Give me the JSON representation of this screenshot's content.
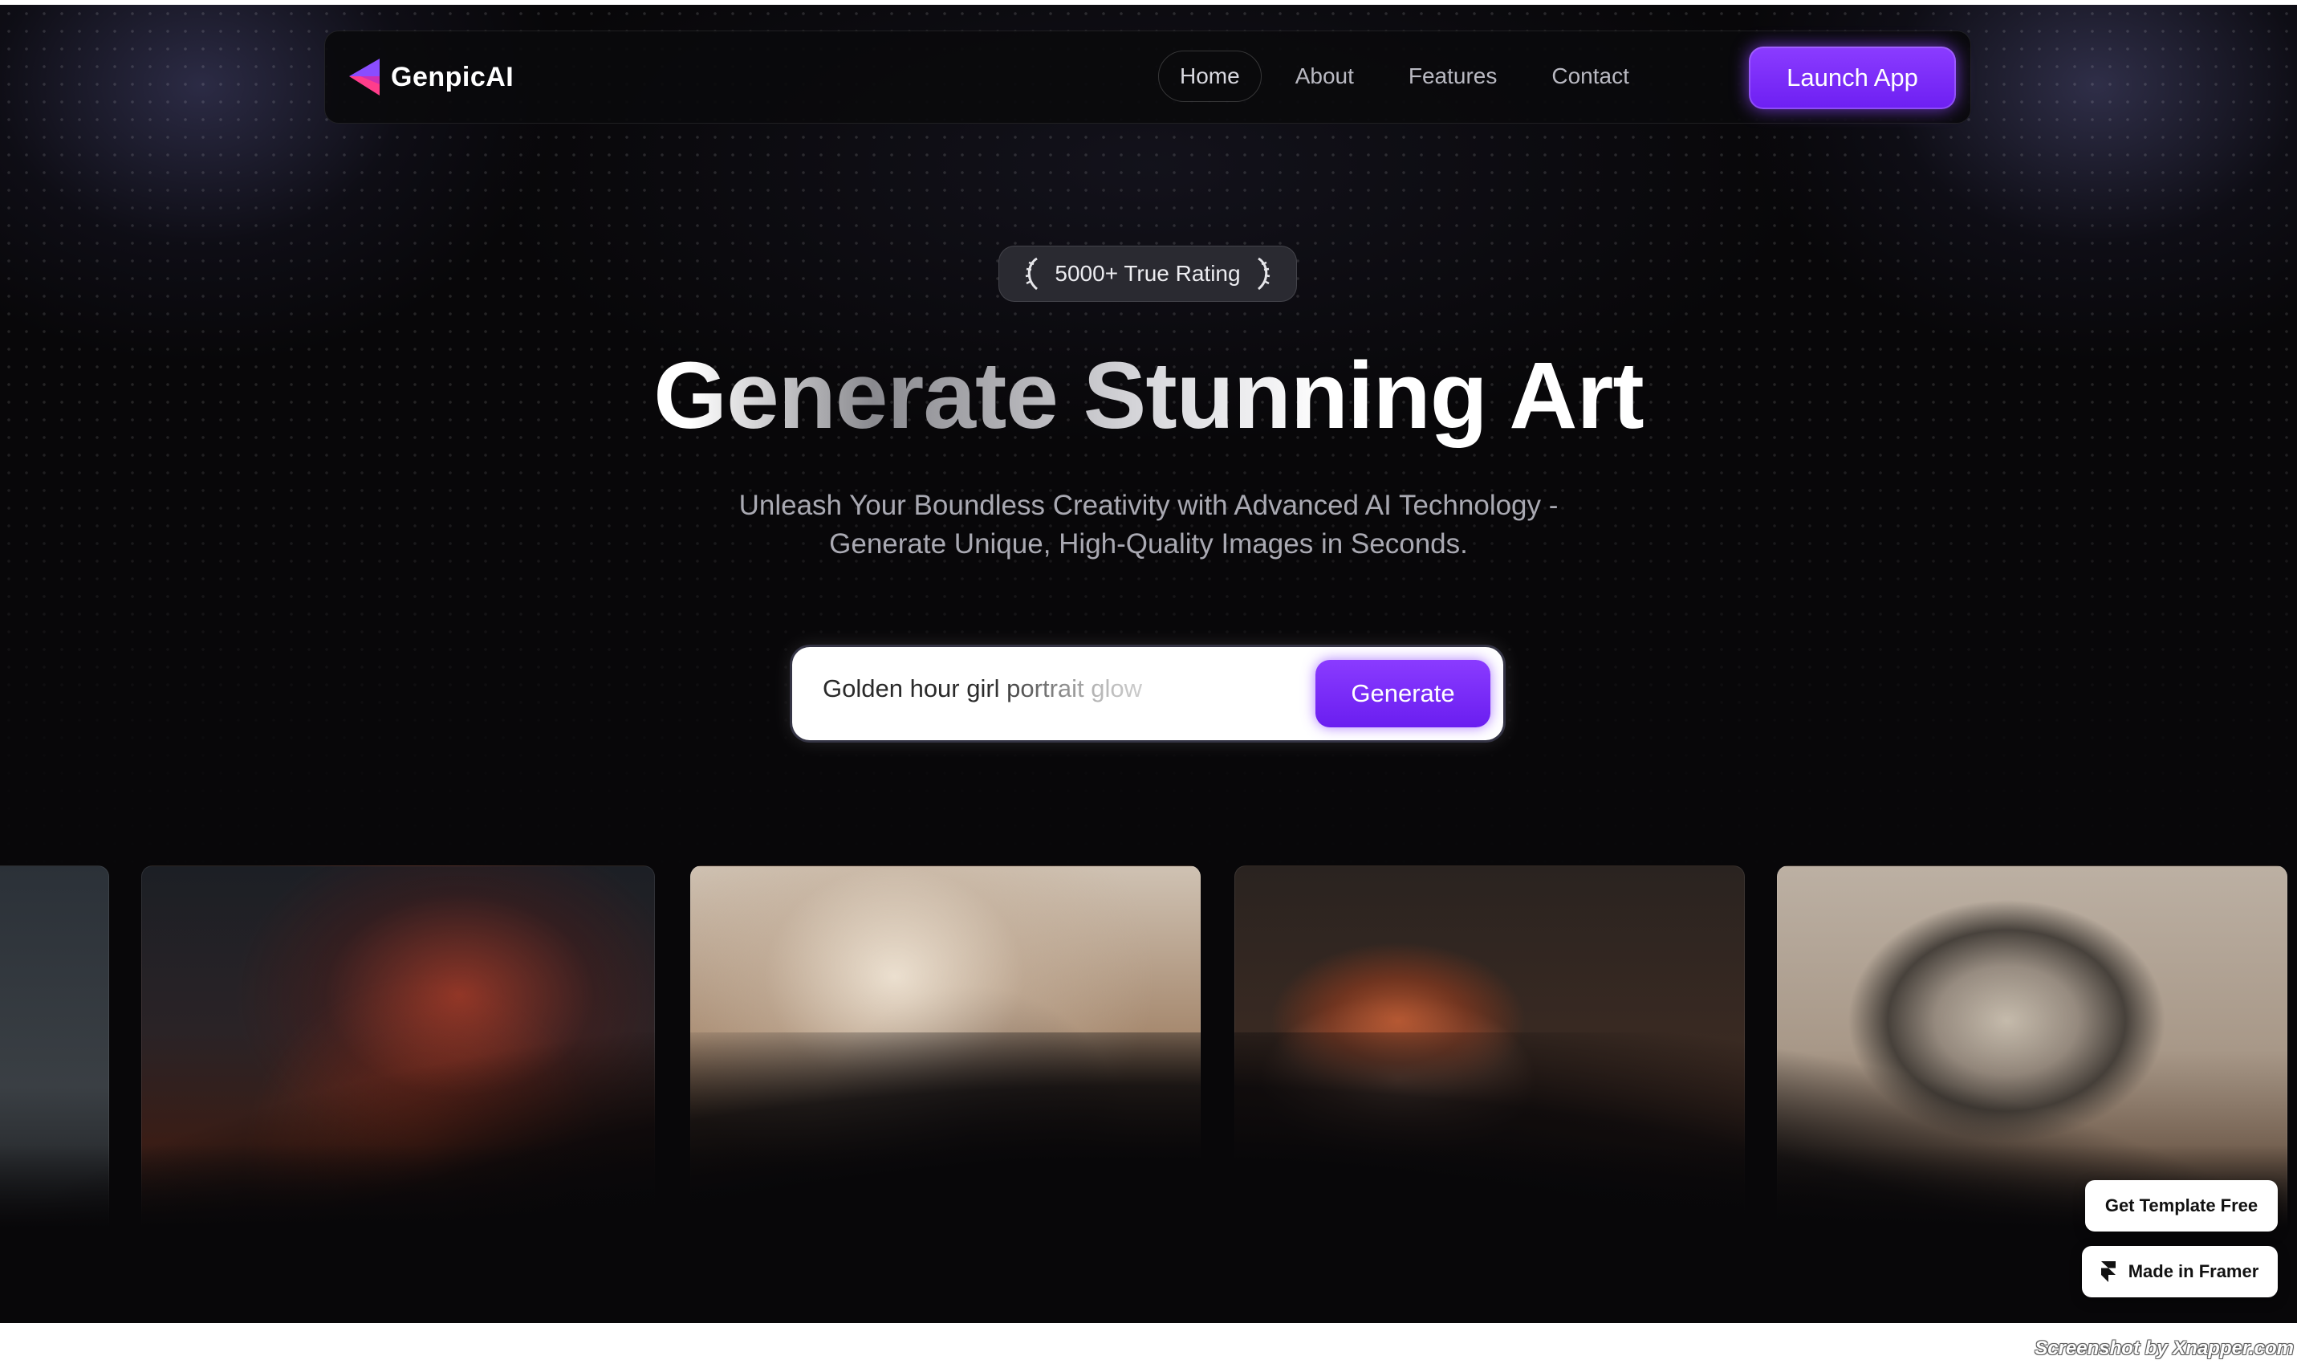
{
  "brand": {
    "name": "GenpicAI"
  },
  "nav": {
    "links": [
      {
        "label": "Home"
      },
      {
        "label": "About"
      },
      {
        "label": "Features"
      },
      {
        "label": "Contact"
      }
    ],
    "launch_label": "Launch App"
  },
  "hero": {
    "badge": "5000+ True Rating",
    "title": "Generate Stunning Art",
    "subtitle_line1": "Unleash Your Boundless Creativity with Advanced AI Technology -",
    "subtitle_line2": "Generate Unique, High-Quality Images in Seconds."
  },
  "prompt": {
    "value": "Golden hour girl portrait glow",
    "generate_label": "Generate"
  },
  "corner": {
    "template_label": "Get Template Free",
    "framer_label": "Made in Framer"
  },
  "watermark": "Screenshot by Xnapper.com",
  "colors": {
    "accent": "#7b2cff",
    "background": "#080709"
  },
  "icons": [
    "logo-triangle-icon",
    "laurel-left-icon",
    "laurel-right-icon",
    "framer-icon"
  ]
}
